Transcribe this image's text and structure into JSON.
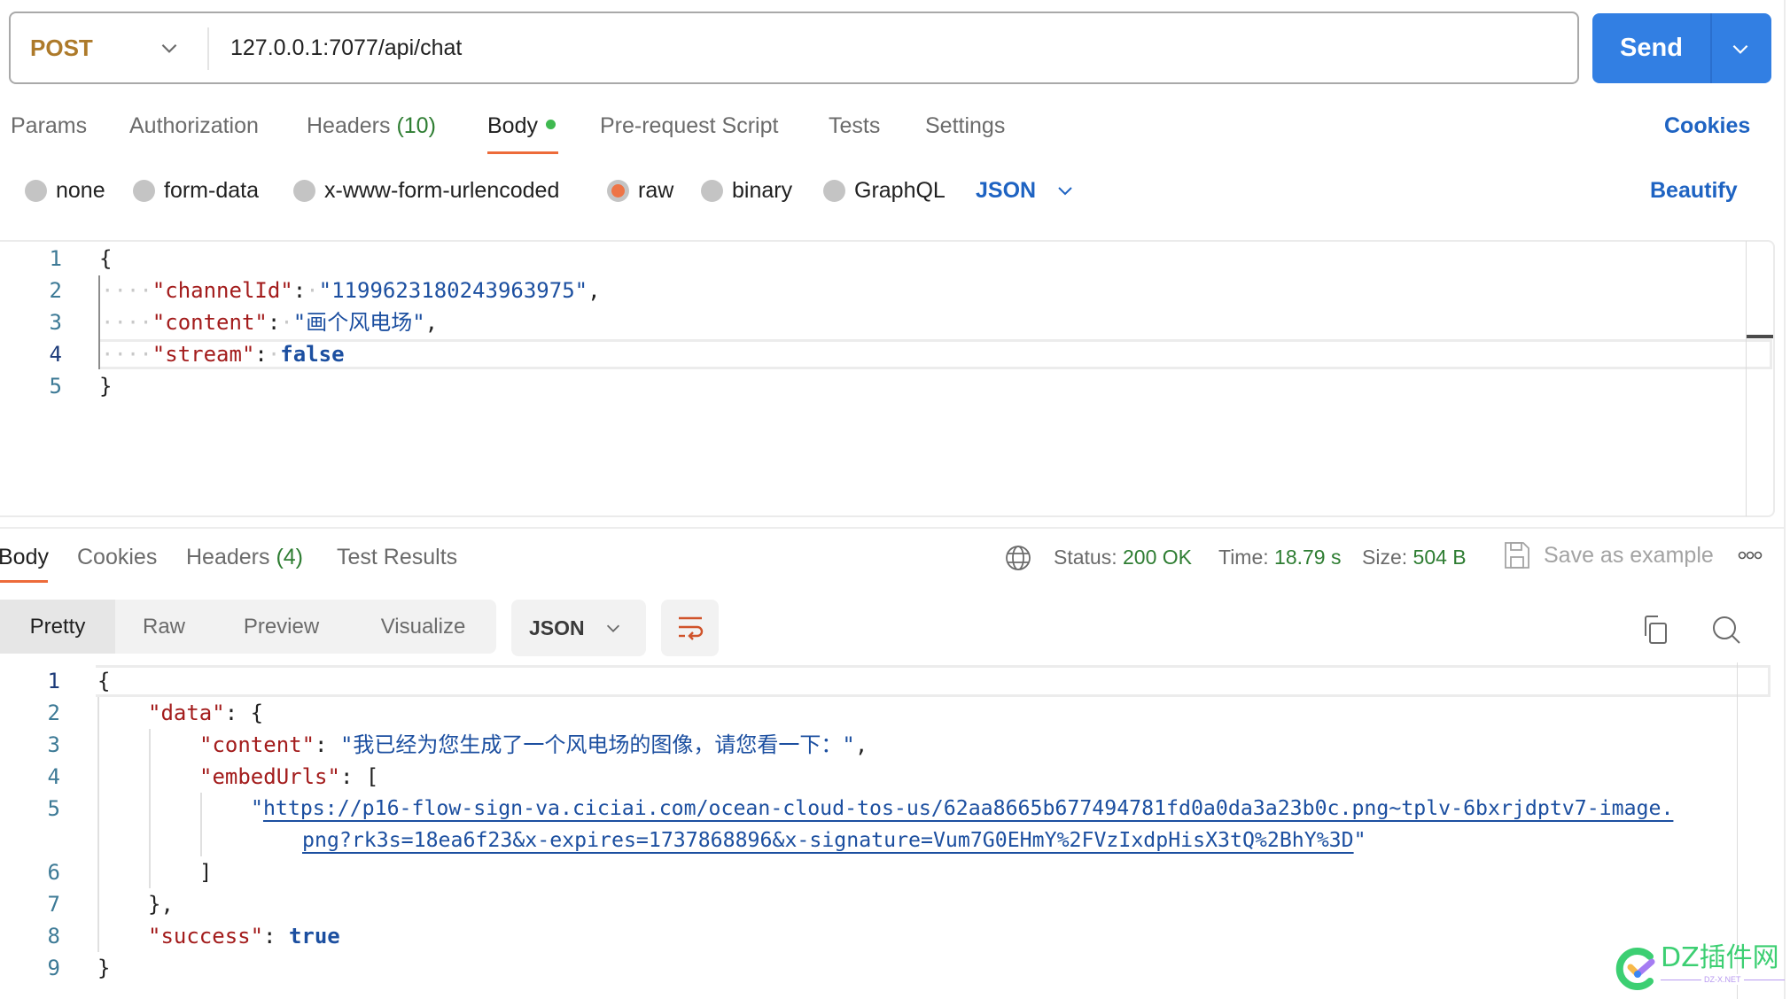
{
  "request": {
    "method": "POST",
    "url": "127.0.0.1:7077/api/chat",
    "send_label": "Send"
  },
  "request_tabs": [
    {
      "label": "Params"
    },
    {
      "label": "Authorization"
    },
    {
      "label": "Headers",
      "count": "(10)"
    },
    {
      "label": "Body",
      "active": true,
      "indicator": "green-dot"
    },
    {
      "label": "Pre-request Script"
    },
    {
      "label": "Tests"
    },
    {
      "label": "Settings"
    }
  ],
  "cookies_link": "Cookies",
  "body_types": [
    {
      "label": "none",
      "selected": false
    },
    {
      "label": "form-data",
      "selected": false
    },
    {
      "label": "x-www-form-urlencoded",
      "selected": false
    },
    {
      "label": "raw",
      "selected": true
    },
    {
      "label": "binary",
      "selected": false
    },
    {
      "label": "GraphQL",
      "selected": false
    }
  ],
  "body_language": "JSON",
  "beautify_label": "Beautify",
  "request_body": {
    "line_numbers": [
      "1",
      "2",
      "3",
      "4",
      "5"
    ],
    "current_line": 4,
    "lines": {
      "l1": "{",
      "l2_key": "\"channelId\"",
      "l2_val": "\"1199623180243963975\"",
      "l3_key": "\"content\"",
      "l3_val": "\"画个风电场\"",
      "l4_key": "\"stream\"",
      "l4_val": "false",
      "l5": "}"
    }
  },
  "response_tabs": [
    {
      "label": "Body",
      "active": true
    },
    {
      "label": "Cookies"
    },
    {
      "label": "Headers",
      "count": "(4)"
    },
    {
      "label": "Test Results"
    }
  ],
  "response_status": {
    "status_label": "Status:",
    "status_value": "200 OK",
    "time_label": "Time:",
    "time_value": "18.79 s",
    "size_label": "Size:",
    "size_value": "504 B",
    "save_example_label": "Save as example"
  },
  "response_views": [
    {
      "label": "Pretty",
      "active": true
    },
    {
      "label": "Raw"
    },
    {
      "label": "Preview"
    },
    {
      "label": "Visualize"
    }
  ],
  "response_format": "JSON",
  "response_body": {
    "line_numbers": [
      "1",
      "2",
      "3",
      "4",
      "5",
      "",
      "6",
      "7",
      "8",
      "9"
    ],
    "lines": {
      "l1": "{",
      "l2_key": "\"data\"",
      "l2_rest": ": {",
      "l3_key": "\"content\"",
      "l3_val": "\"我已经为您生成了一个风电场的图像，请您看一下：\"",
      "l4_key": "\"embedUrls\"",
      "l4_rest": ": [",
      "l5_url_part1": "https://p16-flow-sign-va.ciciai.com/ocean-cloud-tos-us/62aa8665b677494781fd0a0da3a23b0c.png~tplv-6bxrjdptv7-image.",
      "l5_url_part2": "png?rk3s=18ea6f23&x-expires=1737868896&x-signature=Vum7G0EHmY%2FVzIxdpHisX3tQ%2BhY%3D",
      "l6": "]",
      "l7": "},",
      "l8_key": "\"success\"",
      "l8_val": "true",
      "l9": "}"
    }
  },
  "watermark": {
    "text": "DZ插件网",
    "subtext": "DZ-X.NET"
  },
  "colors": {
    "accent_blue": "#327fe3",
    "link_blue": "#1e63c2",
    "method_post": "#ad7a2a",
    "active_underline": "#ed6b3a",
    "success_green": "#2e7d32"
  }
}
